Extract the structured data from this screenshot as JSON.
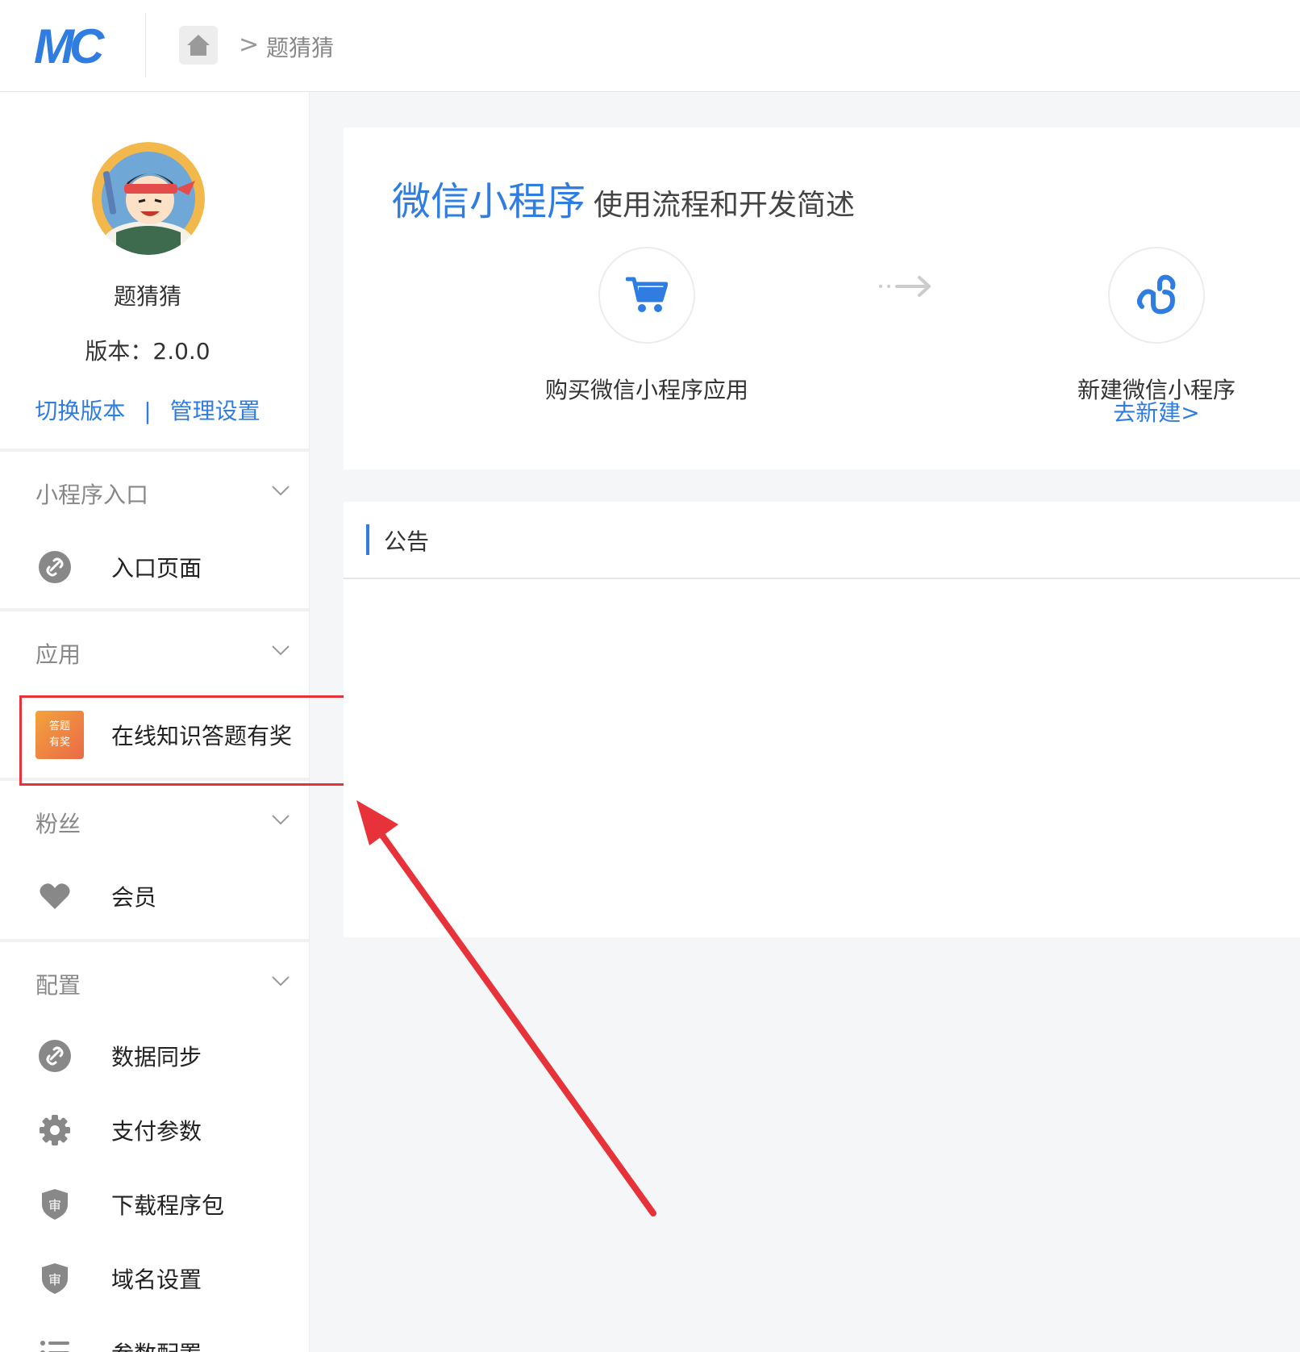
{
  "header": {
    "logo_text": "MC",
    "breadcrumb": {
      "home_icon": "home-icon",
      "separator": ">",
      "current": "题猜猜"
    }
  },
  "sidebar": {
    "user": {
      "name": "题猜猜",
      "version_label": "版本：",
      "version_value": "2.0.0"
    },
    "links": {
      "switch_version": "切换版本",
      "divider": "|",
      "manage_settings": "管理设置"
    },
    "sections": [
      {
        "title": "小程序入口",
        "items": [
          {
            "label": "入口页面",
            "icon": "link-icon"
          }
        ]
      },
      {
        "title": "应用",
        "items": [
          {
            "label": "在线知识答题有奖",
            "icon": "app-thumbnail",
            "thumb_text": [
              "答题",
              "有奖"
            ]
          }
        ]
      },
      {
        "title": "粉丝",
        "items": [
          {
            "label": "会员",
            "icon": "heart-icon"
          }
        ]
      },
      {
        "title": "配置",
        "items": [
          {
            "label": "数据同步",
            "icon": "link-icon"
          },
          {
            "label": "支付参数",
            "icon": "gear-icon"
          },
          {
            "label": "下载程序包",
            "icon": "shield-icon"
          },
          {
            "label": "域名设置",
            "icon": "shield-icon"
          },
          {
            "label": "参数配置",
            "icon": "list-icon"
          }
        ]
      }
    ],
    "shield_glyph": "审"
  },
  "main": {
    "title_big": "微信小程序",
    "title_small": "使用流程和开发简述",
    "steps": [
      {
        "label": "购买微信小程序应用",
        "icon": "cart-icon"
      },
      {
        "label": "新建微信小程序",
        "icon": "miniprogram-icon",
        "link": "去新建>"
      }
    ]
  },
  "notice": {
    "title": "公告"
  },
  "colors": {
    "accent": "#2f7de1",
    "highlight": "#e8323a",
    "icon_gray": "#888888"
  }
}
